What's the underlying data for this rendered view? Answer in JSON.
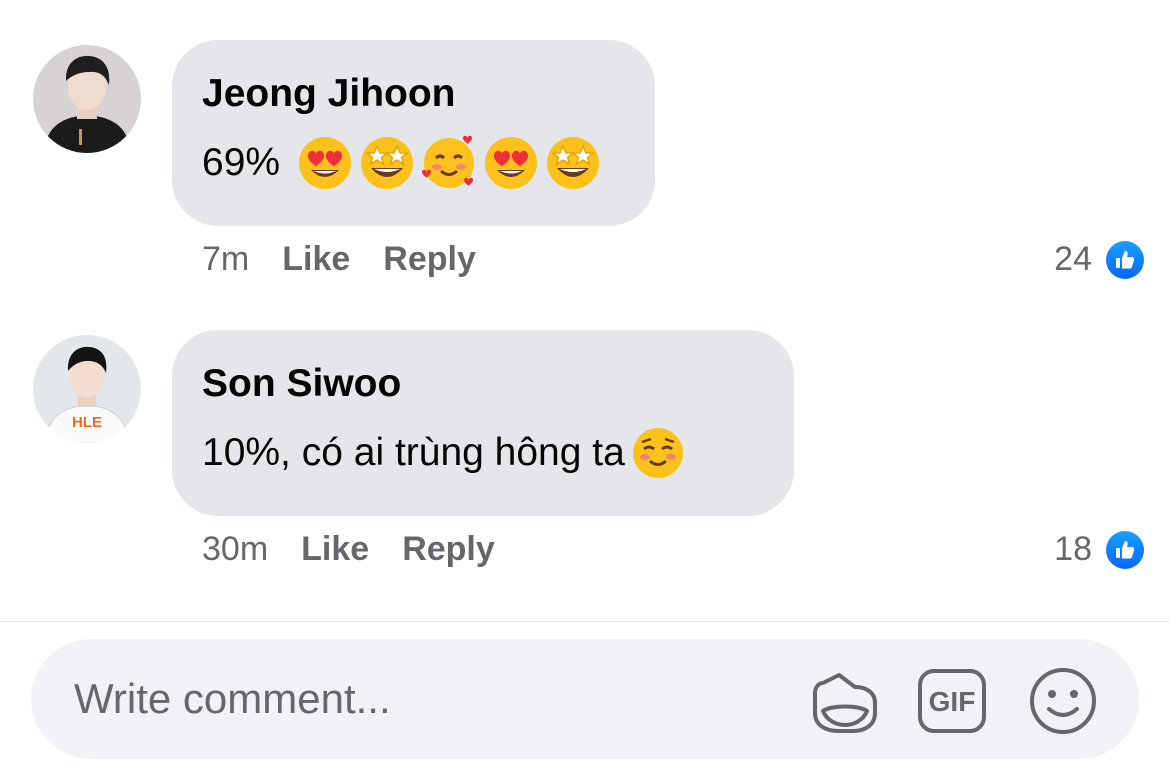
{
  "comments": [
    {
      "author": "Jeong Jihoon",
      "text": "69%",
      "emojis": [
        "heart-eyes",
        "star-struck",
        "smiling-hearts",
        "heart-eyes",
        "star-struck"
      ],
      "time": "7m",
      "like_label": "Like",
      "reply_label": "Reply",
      "reaction_count": "24"
    },
    {
      "author": "Son Siwoo",
      "text": "10%, có ai trùng hông ta",
      "emojis": [
        "smiling-blush"
      ],
      "time": "30m",
      "like_label": "Like",
      "reply_label": "Reply",
      "reaction_count": "18",
      "avatar_shirt_text": "HLE"
    }
  ],
  "composer": {
    "placeholder": "Write comment...",
    "gif_label": "GIF"
  },
  "colors": {
    "bubble": "#e4e6e9",
    "meta_text": "#65676b",
    "like_blue": "#0866ff",
    "composer_bg": "#f0f2f5",
    "emoji_yellow": "#fcc21b"
  }
}
